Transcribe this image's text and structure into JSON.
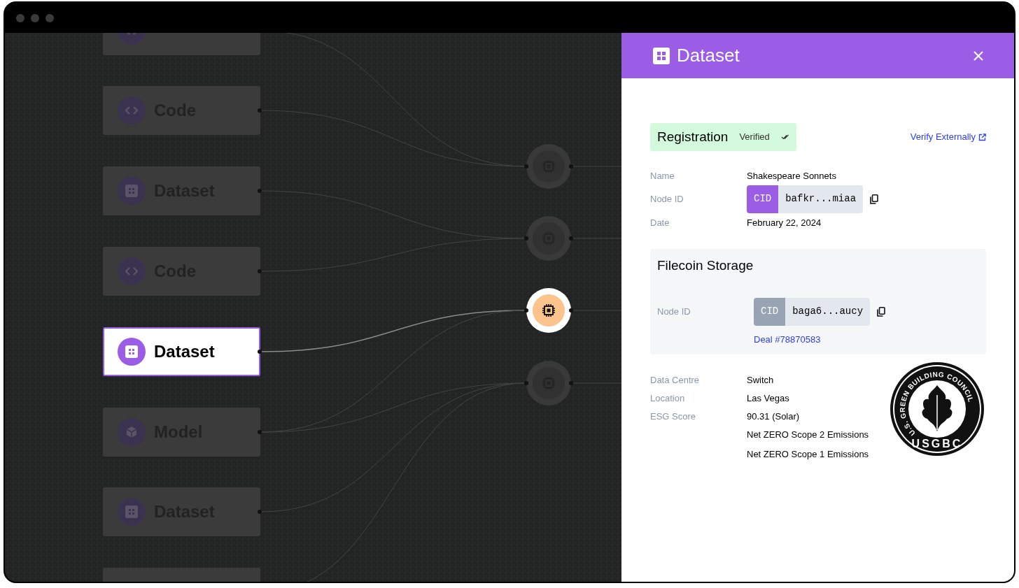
{
  "canvas": {
    "nodes": [
      {
        "kind": "code",
        "selected": false
      },
      {
        "kind": "code",
        "label": "Code",
        "selected": false
      },
      {
        "kind": "dataset",
        "label": "Dataset",
        "selected": false
      },
      {
        "kind": "code",
        "label": "Code",
        "selected": false
      },
      {
        "kind": "dataset",
        "label": "Dataset",
        "selected": true
      },
      {
        "kind": "model",
        "label": "Model",
        "selected": false
      },
      {
        "kind": "dataset",
        "label": "Dataset",
        "selected": false
      },
      {
        "kind": "blank",
        "selected": false
      }
    ],
    "processors": [
      {
        "selected": false
      },
      {
        "selected": false
      },
      {
        "selected": true
      },
      {
        "selected": false
      }
    ]
  },
  "panel": {
    "title": "Dataset",
    "registration": {
      "title": "Registration",
      "status": "Verified",
      "link": "Verify Externally"
    },
    "fields": [
      {
        "kind": "text",
        "label": "Name",
        "value": "Shakespeare Sonnets"
      },
      {
        "kind": "cid",
        "label": "Node ID",
        "tag": "CID",
        "value": "bafkr...miaa",
        "color": "#9b5de5"
      },
      {
        "kind": "text",
        "label": "Date",
        "value": "February 22, 2024"
      }
    ],
    "storage": {
      "title": "Filecoin Storage",
      "fields": [
        {
          "kind": "cid",
          "label": "Node ID",
          "tag": "CID",
          "value": "baga6...aucy",
          "color": "#98a4b3",
          "link": "Deal #78870583"
        }
      ]
    },
    "details": [
      {
        "label": "Data Centre",
        "value": "Switch"
      },
      {
        "label": "Location",
        "value": "Las Vegas"
      },
      {
        "label": "ESG Score",
        "value": "90.31 (Solar)"
      },
      {
        "value": "Net ZERO Scope 2 Emissions"
      },
      {
        "value": "Net ZERO Scope 1 Emissions"
      }
    ],
    "logo": {
      "ring_text": "U.S. GREEN BUILDING COUNCIL",
      "center_text": "USGBC"
    }
  }
}
